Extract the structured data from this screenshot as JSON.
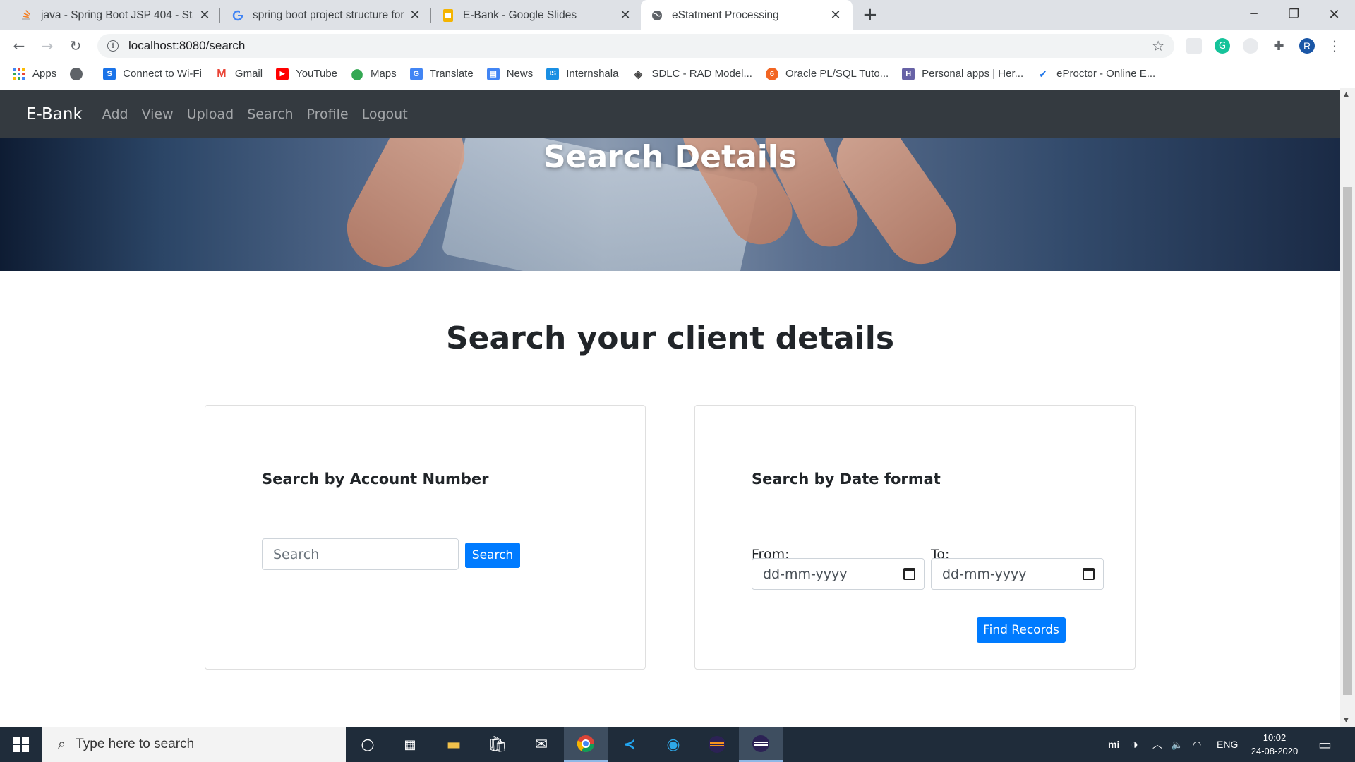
{
  "browser": {
    "tabs": [
      {
        "title": "java - Spring Boot JSP 404 - Stack",
        "active": false
      },
      {
        "title": "spring boot project structure for",
        "active": false
      },
      {
        "title": "E-Bank - Google Slides",
        "active": false
      },
      {
        "title": "eStatment Processing",
        "active": true
      }
    ],
    "url": "localhost:8080/search",
    "profile_initial": "R",
    "bookmarks": [
      {
        "label": "Apps",
        "icon": "apps-grid-icon",
        "color": "#4285f4"
      },
      {
        "label": "",
        "icon": "globe-icon",
        "color": "#5f6368"
      },
      {
        "label": "Connect to Wi-Fi",
        "icon": "s-logo-icon",
        "color": "#1a73e8"
      },
      {
        "label": "Gmail",
        "icon": "gmail-icon",
        "color": "#ea4335"
      },
      {
        "label": "YouTube",
        "icon": "youtube-icon",
        "color": "#ff0000"
      },
      {
        "label": "Maps",
        "icon": "maps-pin-icon",
        "color": "#34a853"
      },
      {
        "label": "Translate",
        "icon": "translate-icon",
        "color": "#4285f4"
      },
      {
        "label": "News",
        "icon": "news-icon",
        "color": "#4285f4"
      },
      {
        "label": "Internshala",
        "icon": "internshala-icon",
        "color": "#1a8fe3"
      },
      {
        "label": "SDLC - RAD Model...",
        "icon": "diamond-icon",
        "color": "#444444"
      },
      {
        "label": "Oracle PL/SQL Tuto...",
        "icon": "oracle-icon",
        "color": "#f26522"
      },
      {
        "label": "Personal apps | Her...",
        "icon": "heroku-icon",
        "color": "#6762a6"
      },
      {
        "label": "eProctor - Online E...",
        "icon": "check-icon",
        "color": "#1a73e8"
      }
    ]
  },
  "app": {
    "brand": "E-Bank",
    "nav": [
      "Add",
      "View",
      "Upload",
      "Search",
      "Profile",
      "Logout"
    ],
    "hero_title": "Search Details",
    "page_heading": "Search your client details",
    "account_card": {
      "title": "Search by Account Number",
      "input_placeholder": "Search",
      "button": "Search"
    },
    "date_card": {
      "title": "Search by Date format",
      "from_label": "From:",
      "to_label": "To:",
      "from_placeholder": "dd-mm-yyyy",
      "to_placeholder": "dd-mm-yyyy",
      "button": "Find Records"
    },
    "colors": {
      "navbar": "#343a40",
      "primary": "#007bff"
    }
  },
  "taskbar": {
    "search_placeholder": "Type here to search",
    "language": "ENG",
    "time": "10:02",
    "date": "24-08-2020"
  }
}
